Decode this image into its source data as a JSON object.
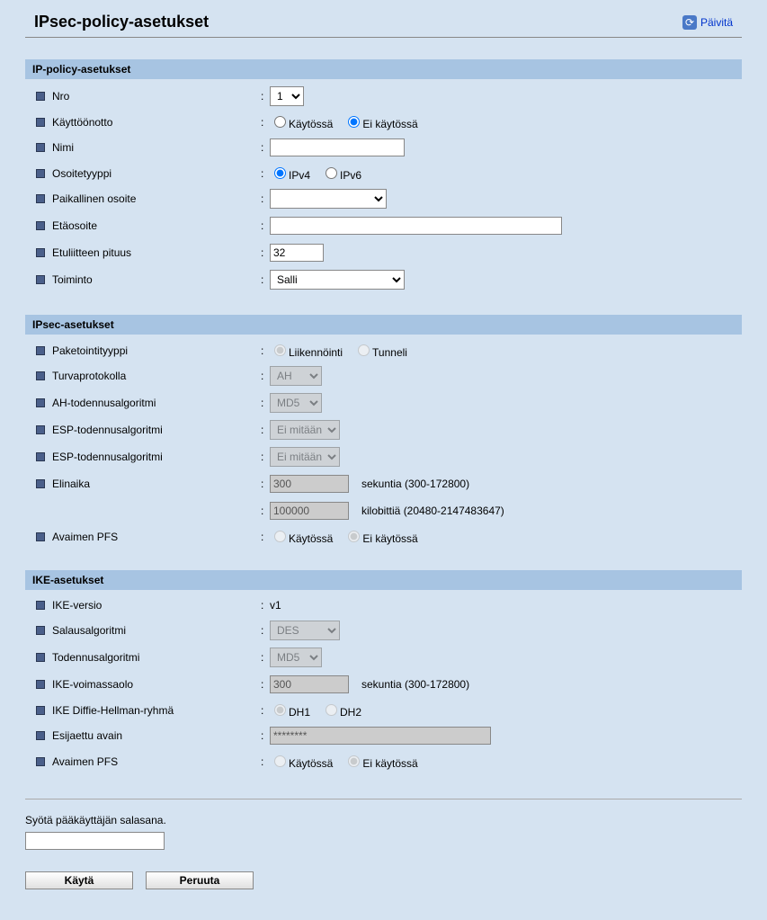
{
  "header": {
    "title": "IPsec-policy-asetukset",
    "refresh": "Päivitä"
  },
  "sections": {
    "ip_policy": {
      "title": "IP-policy-asetukset",
      "nro_label": "Nro",
      "nro_value": "1",
      "enable_label": "Käyttöönotto",
      "enable_on": "Käytössä",
      "enable_off": "Ei käytössä",
      "name_label": "Nimi",
      "name_value": "",
      "addrtype_label": "Osoitetyyppi",
      "ipv4": "IPv4",
      "ipv6": "IPv6",
      "local_label": "Paikallinen osoite",
      "remote_label": "Etäosoite",
      "remote_value": "",
      "prefix_label": "Etuliitteen pituus",
      "prefix_value": "32",
      "action_label": "Toiminto",
      "action_value": "Salli"
    },
    "ipsec": {
      "title": "IPsec-asetukset",
      "packet_label": "Paketointityyppi",
      "packet_transport": "Liikennöinti",
      "packet_tunnel": "Tunneli",
      "secproto_label": "Turvaprotokolla",
      "secproto_value": "AH",
      "ahauth_label": "AH-todennusalgoritmi",
      "ahauth_value": "MD5",
      "espauth1_label": "ESP-todennusalgoritmi",
      "espauth1_value": "Ei mitään",
      "espauth2_label": "ESP-todennusalgoritmi",
      "espauth2_value": "Ei mitään",
      "life_label": "Elinaika",
      "life_sec_value": "300",
      "life_sec_suffix": "sekuntia (300-172800)",
      "life_kb_value": "100000",
      "life_kb_suffix": "kilobittiä (20480-2147483647)",
      "pfs_label": "Avaimen PFS",
      "pfs_on": "Käytössä",
      "pfs_off": "Ei käytössä"
    },
    "ike": {
      "title": "IKE-asetukset",
      "ver_label": "IKE-versio",
      "ver_value": "v1",
      "enc_label": "Salausalgoritmi",
      "enc_value": "DES",
      "auth_label": "Todennusalgoritmi",
      "auth_value": "MD5",
      "life_label": "IKE-voimassaolo",
      "life_value": "300",
      "life_suffix": "sekuntia (300-172800)",
      "dh_label": "IKE Diffie-Hellman-ryhmä",
      "dh1": "DH1",
      "dh2": "DH2",
      "psk_label": "Esijaettu avain",
      "psk_value": "********",
      "pfs_label": "Avaimen PFS",
      "pfs_on": "Käytössä",
      "pfs_off": "Ei käytössä"
    }
  },
  "footer": {
    "prompt": "Syötä pääkäyttäjän salasana.",
    "apply": "Käytä",
    "cancel": "Peruuta"
  }
}
